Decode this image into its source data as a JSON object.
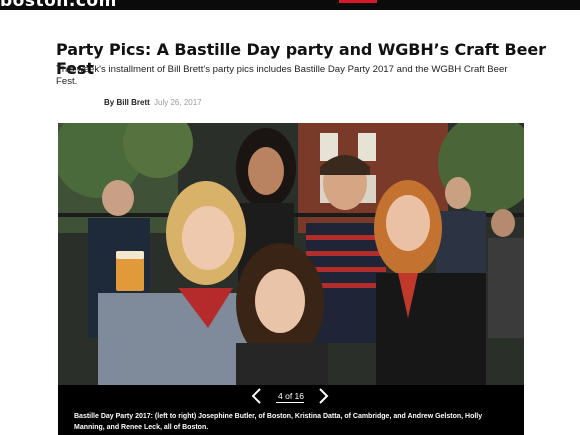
{
  "site": {
    "logo": "boston.com"
  },
  "article": {
    "headline": "Party Pics: A Bastille Day party and WGBH’s Craft Beer Fest",
    "dek": "This week's installment of Bill Brett's party pics includes Bastille Day Party 2017 and the WGBH Craft Beer Fest.",
    "byline_prefix": "By Bill Brett",
    "date": "July 26, 2017"
  },
  "gallery": {
    "counter": "4 of 16",
    "caption": "Bastille Day Party 2017: (left to right) Josephine Butler, of Boston, Kristina Datta, of Cambridge, and Andrew Gelston, Holly Manning, and Renee Leck, all of Boston.",
    "prev_icon": "chevron-left-icon",
    "next_icon": "chevron-right-icon"
  },
  "colors": {
    "topbar": "#0b0b0b",
    "accent": "#d6192a",
    "date": "#9a9a9a"
  }
}
